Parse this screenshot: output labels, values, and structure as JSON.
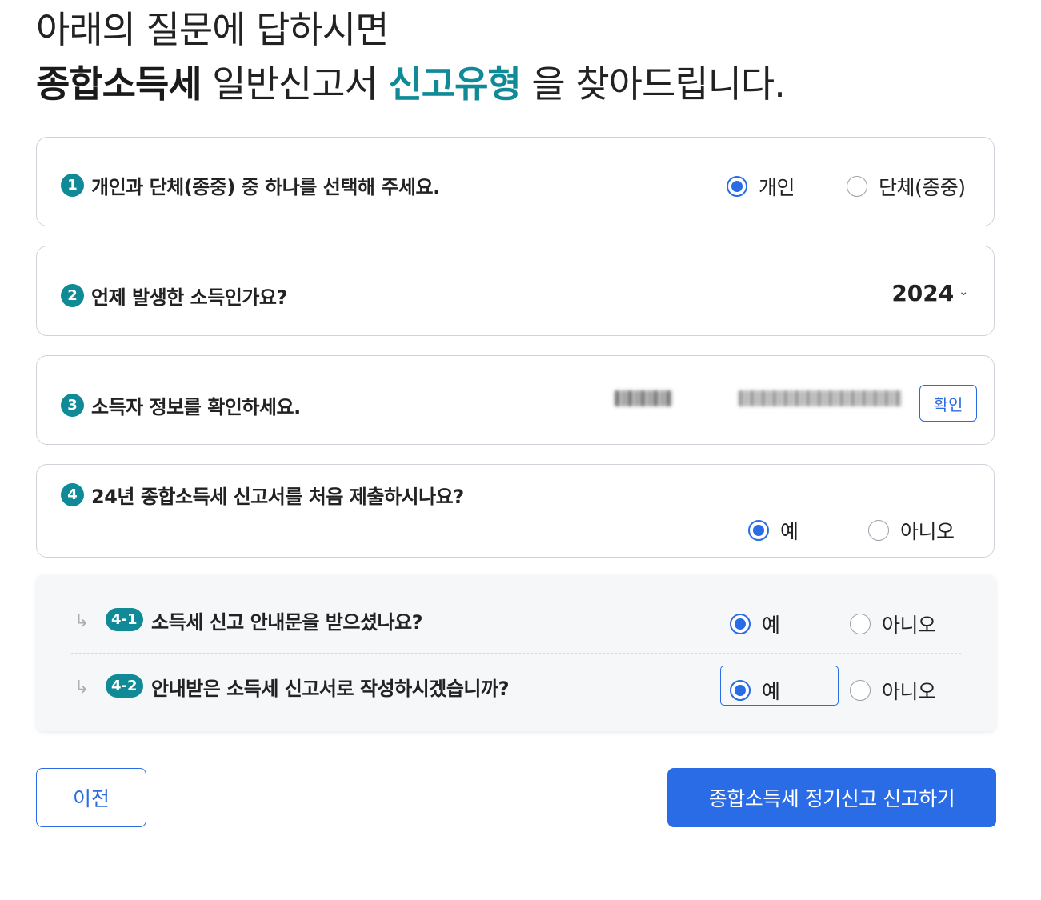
{
  "title": {
    "line1": "아래의 질문에 답하시면",
    "line2_bold": "종합소득세",
    "line2_mid": " 일반신고서 ",
    "line2_accent": "신고유형",
    "line2_end": " 을 찾아드립니다."
  },
  "q1": {
    "number": "1",
    "text": "개인과 단체(종중) 중 하나를 선택해 주세요.",
    "options": [
      "개인",
      "단체(종중)"
    ],
    "selected": "개인"
  },
  "q2": {
    "number": "2",
    "text": "언제 발생한 소득인가요?",
    "year": "2024"
  },
  "q3": {
    "number": "3",
    "text": "소득자 정보를 확인하세요.",
    "confirm_label": "확인"
  },
  "q4": {
    "number": "4",
    "text": "24년 종합소득세 신고서를 처음 제출하시나요?",
    "options": [
      "예",
      "아니오"
    ],
    "selected": "예"
  },
  "q4_1": {
    "number": "4-1",
    "text": "소득세 신고 안내문을 받으셨나요?",
    "options": [
      "예",
      "아니오"
    ],
    "selected": "예"
  },
  "q4_2": {
    "number": "4-2",
    "text": "안내받은 소득세 신고서로 작성하시겠습니까?",
    "options": [
      "예",
      "아니오"
    ],
    "selected": "예"
  },
  "footer": {
    "prev_label": "이전",
    "submit_label": "종합소득세 정기신고 신고하기"
  },
  "colors": {
    "accent_teal": "#0f8a96",
    "primary_blue": "#2a6be6"
  }
}
